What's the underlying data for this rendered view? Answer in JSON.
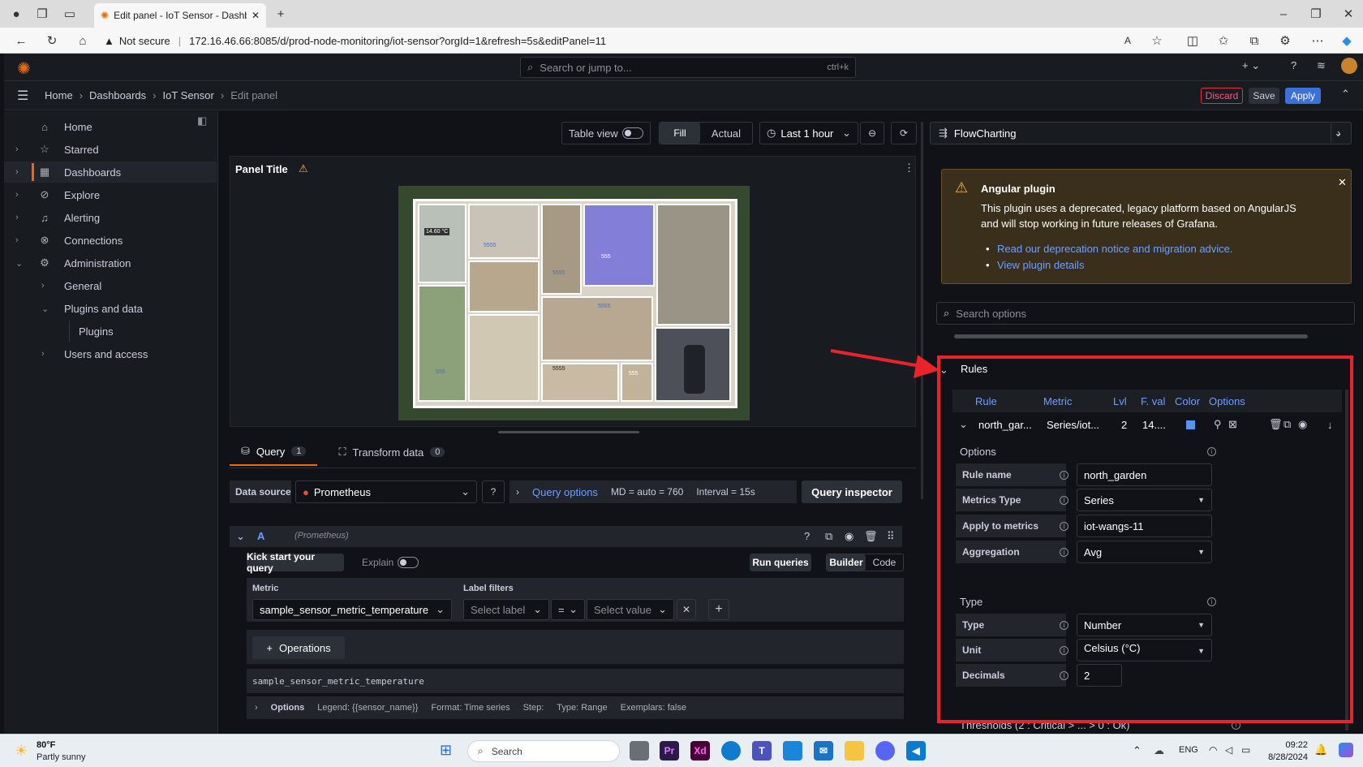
{
  "browser": {
    "tab_title": "Edit panel - IoT Sensor - Dashbo",
    "not_secure": "Not secure",
    "url": "172.16.46.66:8085/d/prod-node-monitoring/iot-sensor?orgId=1&refresh=5s&editPanel=11"
  },
  "grafana": {
    "search_placeholder": "Search or jump to...",
    "search_shortcut": "ctrl+k",
    "breadcrumb": [
      "Home",
      "Dashboards",
      "IoT Sensor",
      "Edit panel"
    ],
    "discard": "Discard",
    "save": "Save",
    "apply": "Apply"
  },
  "sidebar": {
    "items": [
      {
        "label": "Home",
        "icon": "home-icon"
      },
      {
        "label": "Starred",
        "icon": "star-icon"
      },
      {
        "label": "Dashboards",
        "icon": "grid-icon"
      },
      {
        "label": "Explore",
        "icon": "compass-icon"
      },
      {
        "label": "Alerting",
        "icon": "bell-icon"
      },
      {
        "label": "Connections",
        "icon": "plug-icon"
      },
      {
        "label": "Administration",
        "icon": "gear-icon"
      },
      {
        "label": "General"
      },
      {
        "label": "Plugins and data"
      },
      {
        "label": "Plugins"
      },
      {
        "label": "Users and access"
      }
    ]
  },
  "toolbar": {
    "table_view": "Table view",
    "fill": "Fill",
    "actual": "Actual",
    "time_range": "Last 1 hour"
  },
  "panel": {
    "title": "Panel Title",
    "floorplan_labels": [
      "14.60 °C",
      "5555",
      "5555",
      "5555",
      "555",
      "5555",
      "555",
      "555"
    ]
  },
  "query": {
    "tab_query": "Query",
    "tab_query_count": "1",
    "tab_transform": "Transform data",
    "tab_transform_count": "0",
    "data_source_label": "Data source",
    "data_source": "Prometheus",
    "query_options": "Query options",
    "md": "MD = auto = 760",
    "interval": "Interval = 15s",
    "inspector": "Query inspector",
    "row_letter": "A",
    "row_source": "(Prometheus)",
    "kick_start": "Kick start your query",
    "explain": "Explain",
    "run": "Run queries",
    "builder": "Builder",
    "code": "Code",
    "metric_label": "Metric",
    "metric_value": "sample_sensor_metric_temperature",
    "label_filters": "Label filters",
    "select_label": "Select label",
    "op": "=",
    "select_value": "Select value",
    "operations": "Operations",
    "expression": "sample_sensor_metric_temperature",
    "options_label": "Options",
    "legend": "Legend: {{sensor_name}}",
    "format": "Format: Time series",
    "step": "Step:",
    "type": "Type: Range",
    "exemplars": "Exemplars: false"
  },
  "right": {
    "plugin": "FlowCharting",
    "angular_title": "Angular plugin",
    "angular_text": "This plugin uses a deprecated, legacy platform based on AngularJS and will stop working in future releases of Grafana.",
    "link1": "Read our deprecation notice and migration advice.",
    "link2": "View plugin details",
    "search_options": "Search options",
    "rules_title": "Rules",
    "headers": [
      "Rule",
      "Metric",
      "Lvl",
      "F. val",
      "Color",
      "Options"
    ],
    "rule_row": {
      "rule": "north_gar...",
      "metric": "Series/iot...",
      "lvl": "2",
      "fval": "14...."
    },
    "rule_color": "#5794f2",
    "options_title": "Options",
    "rule_name_label": "Rule name",
    "rule_name": "north_garden",
    "metrics_type_label": "Metrics Type",
    "metrics_type": "Series",
    "apply_metrics_label": "Apply to metrics",
    "apply_metrics": "iot-wangs-11",
    "aggregation_label": "Aggregation",
    "aggregation": "Avg",
    "type_title": "Type",
    "type_label": "Type",
    "type_value": "Number",
    "unit_label": "Unit",
    "unit_value": "Celsius (°C)",
    "decimals_label": "Decimals",
    "decimals_value": "2",
    "thresholds": "Thresholds (2 : Critical > ... > 0 : Ok)"
  },
  "taskbar": {
    "temp": "80°F",
    "weather": "Partly sunny",
    "search": "Search",
    "lang": "ENG",
    "time": "09:22",
    "date": "8/28/2024"
  },
  "colors": {
    "accent": "#3d71d9",
    "discard": "#e02f44",
    "annotation_red": "#e8232a",
    "warning": "#f5b73d"
  }
}
